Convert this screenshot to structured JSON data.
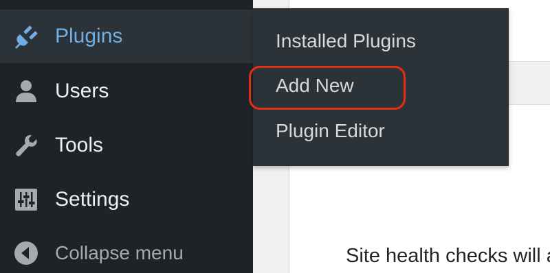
{
  "sidebar": {
    "items": [
      {
        "label": "Plugins",
        "icon": "plugin-icon",
        "current": true
      },
      {
        "label": "Users",
        "icon": "user-icon"
      },
      {
        "label": "Tools",
        "icon": "wrench-icon"
      },
      {
        "label": "Settings",
        "icon": "settings-sliders-icon"
      },
      {
        "label": "Collapse menu",
        "icon": "collapse-arrow-icon"
      }
    ]
  },
  "flyout": {
    "items": [
      {
        "label": "Installed Plugins"
      },
      {
        "label": "Add New",
        "highlighted": true
      },
      {
        "label": "Plugin Editor"
      }
    ]
  },
  "content": {
    "site_health_text": "Site health checks will au"
  },
  "colors": {
    "sidebar_bg": "#1d2327",
    "flyout_bg": "#2c3338",
    "accent": "#72aee6",
    "highlight": "#e62e14"
  }
}
